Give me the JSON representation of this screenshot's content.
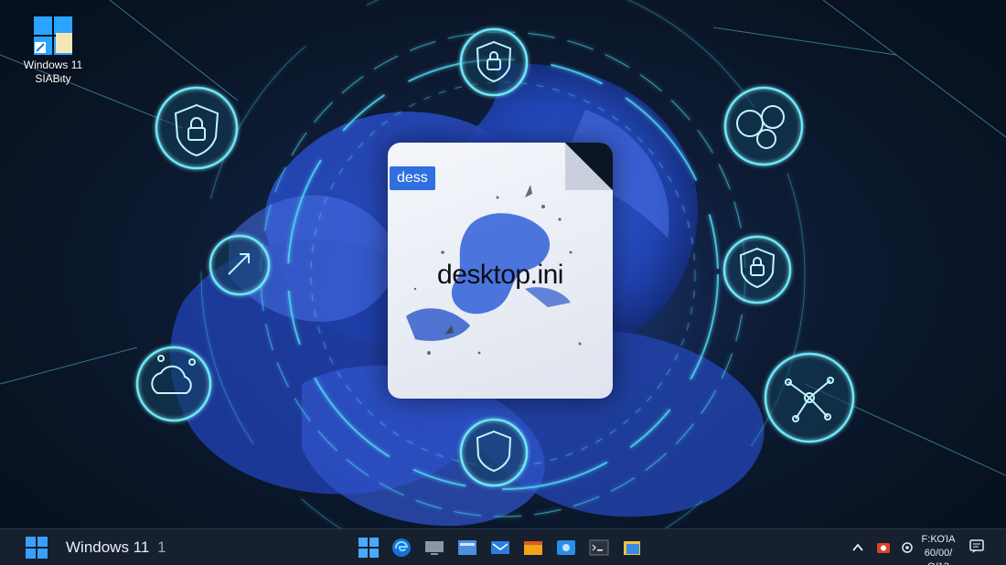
{
  "desktop": {
    "icon": {
      "name": "windows-11-shortcut",
      "title": "Windows 11",
      "subtitle": "SIABιty"
    },
    "file": {
      "tag": "dess",
      "filename": "desktop.ini"
    },
    "security_icons": [
      "shield-lock-icon",
      "lock-icon",
      "cloud-network-icon",
      "network-icon",
      "shield-refresh-icon",
      "shield-arrow-icon",
      "network-nodes-icon"
    ]
  },
  "taskbar": {
    "brand_text": "Windows 11",
    "brand_suffix": "1",
    "apps": [
      "start-icon",
      "edge-icon",
      "monitor-icon",
      "file-explorer-icon",
      "mail-icon",
      "folder-icon",
      "photos-icon",
      "terminal-icon",
      "files-icon"
    ],
    "clock": {
      "time": "F:ΚΟΊΑ",
      "date": "60/00/Ο/13"
    }
  },
  "colors": {
    "accent": "#2f6fe0",
    "glow": "#4fd8f0",
    "taskbar": "#16202e"
  }
}
